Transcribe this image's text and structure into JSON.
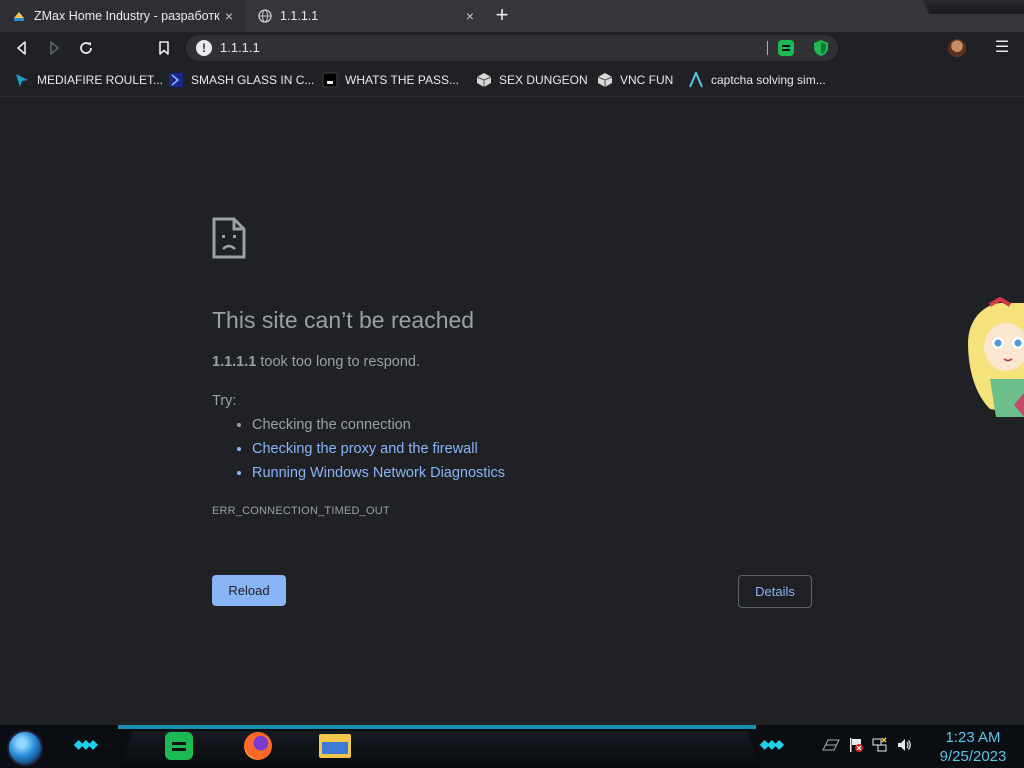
{
  "tabs": [
    {
      "title": "ZMax Home Industry - разработк",
      "close": "×"
    },
    {
      "title": "1.1.1.1",
      "close": "×"
    }
  ],
  "new_tab": "+",
  "toolbar": {
    "back_icon": "back-icon",
    "forward_icon": "forward-icon",
    "reload_icon": "reload-icon",
    "bookmark_icon": "bookmark-icon",
    "url": "1.1.1.1",
    "menu": "☰"
  },
  "bookmarks": [
    {
      "label": "MEDIAFIRE ROULET...",
      "icon": "mediafire-icon"
    },
    {
      "label": "SMASH GLASS IN C...",
      "icon": "smash-icon"
    },
    {
      "label": "WHATS THE PASS...",
      "icon": "terminal-icon"
    },
    {
      "label": "SEX DUNGEON",
      "icon": "cube-icon"
    },
    {
      "label": "VNC FUN",
      "icon": "cube-icon"
    },
    {
      "label": "captcha solving sim...",
      "icon": "arrow-icon"
    }
  ],
  "error": {
    "title": "This site can’t be reached",
    "host": "1.1.1.1",
    "desc_rest": " took too long to respond.",
    "try_label": "Try:",
    "suggestions": [
      "Checking the connection",
      "Checking the proxy and the firewall",
      "Running Windows Network Diagnostics"
    ],
    "code": "ERR_CONNECTION_TIMED_OUT",
    "reload_label": "Reload",
    "details_label": "Details"
  },
  "taskbar": {
    "time": "1:23 AM",
    "date": "9/25/2023",
    "chevrons": "◆◆◆"
  },
  "colors": {
    "background": "#202124",
    "link": "#8ab4f8",
    "text": "#9aa0a6",
    "clock": "#57c7e8"
  }
}
